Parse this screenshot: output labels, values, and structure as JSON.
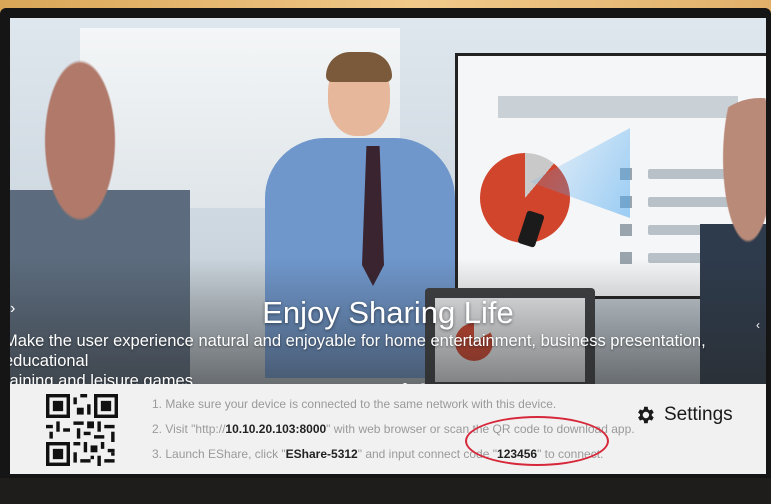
{
  "slide": {
    "headline": "Enjoy Sharing Life",
    "subline_1": "Make the user experience natural and enjoyable for home entertainment, business presentation, educational",
    "subline_2": "raining and leisure games.",
    "prev_arrow": "‹",
    "next_arrow": "‹",
    "page_count": 2,
    "active_page": 1
  },
  "infobar": {
    "step_1_text": "1. Make sure your device is connected to the same network with this device.",
    "step_2_pre": "2. Visit \"http://",
    "step_2_url": "10.10.20.103:8000",
    "step_2_post": "\" with web browser or scan the QR code to download app.",
    "step_3_pre": "3. Launch EShare, click \"",
    "step_3_device": "EShare-5312",
    "step_3_mid": "\" and input connect code \"",
    "step_3_code": "123456",
    "step_3_post": "\" to connect.",
    "settings_label": "Settings",
    "settings_icon": "gear-icon",
    "qr_icon": "qr-code"
  },
  "colors": {
    "accent_annotation": "#d6283a",
    "infobar_bg": "#f1f1f1",
    "step_text": "#9a9a9a"
  }
}
